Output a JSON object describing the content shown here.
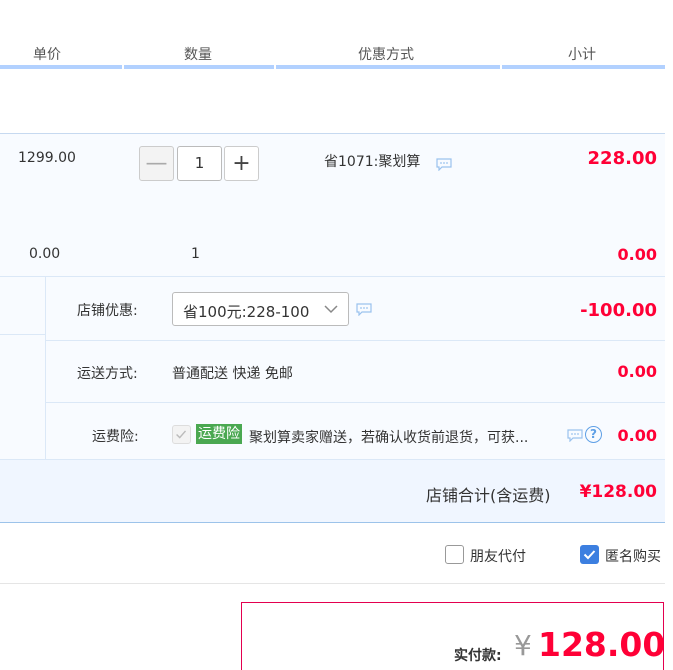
{
  "header": {
    "columns": [
      "单价",
      "数量",
      "优惠方式",
      "小计"
    ]
  },
  "item1": {
    "unit_price": "1299.00",
    "quantity": "1",
    "quantity_minus": "—",
    "quantity_plus": "+",
    "discount": "省1071:聚划算",
    "subtotal": "228.00"
  },
  "item2": {
    "unit_price": "0.00",
    "quantity": "1",
    "subtotal": "0.00"
  },
  "shop_discount": {
    "label": "店铺优惠:",
    "selected": "省100元:228-100",
    "amount": "-100.00"
  },
  "shipping": {
    "label": "运送方式:",
    "value": "普通配送 快递 免邮",
    "amount": "0.00"
  },
  "insurance": {
    "label": "运费险:",
    "badge": "运费险",
    "text": "聚划算卖家赠送，若确认收货前退货，可获...",
    "help_icon": "?",
    "amount": "0.00",
    "checked": true
  },
  "shop_total": {
    "label": "店铺合计(含运费)",
    "amount": "¥128.00"
  },
  "options": {
    "friend_pay": "朋友代付",
    "anonymous": "匿名购买",
    "friend_pay_checked": false,
    "anonymous_checked": true
  },
  "payment": {
    "label": "实付款:",
    "currency": "¥",
    "amount": "128.00"
  },
  "colors": {
    "accent_red": "#ff0036",
    "badge_green": "#4aa851",
    "checkbox_blue": "#3c7fe0"
  }
}
